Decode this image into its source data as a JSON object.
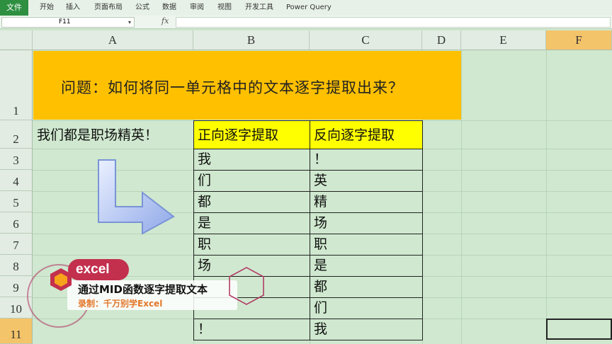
{
  "ribbon": {
    "file": "文件",
    "tabs": [
      "开始",
      "插入",
      "页面布局",
      "公式",
      "数据",
      "审阅",
      "视图",
      "开发工具",
      "Power Query"
    ]
  },
  "formula_bar": {
    "name_box": "F11",
    "fx": "fx"
  },
  "columns": [
    "A",
    "B",
    "C",
    "D",
    "E",
    "F"
  ],
  "rows": [
    "1",
    "2",
    "3",
    "4",
    "5",
    "6",
    "7",
    "8",
    "9",
    "10",
    "11"
  ],
  "sheet": {
    "title": "问题：如何将同一单元格中的文本逐字提取出来？",
    "source_text": "我们都是职场精英！",
    "table": {
      "header_forward": "正向逐字提取",
      "header_reverse": "反向逐字提取",
      "forward": [
        "我",
        "们",
        "都",
        "是",
        "职",
        "场",
        "",
        "",
        "！"
      ],
      "reverse": [
        "！",
        "英",
        "精",
        "场",
        "职",
        "是",
        "都",
        "们",
        "我"
      ]
    }
  },
  "overlay": {
    "brand": "excel",
    "line1": "通过MID函数逐字提取文本",
    "line2": "录制：千万别学Excel"
  },
  "colors": {
    "banner": "#ffc000",
    "table_header": "#ffff00",
    "selected_header": "#f4c46a",
    "sheet_bg": "#cfe8cf"
  }
}
